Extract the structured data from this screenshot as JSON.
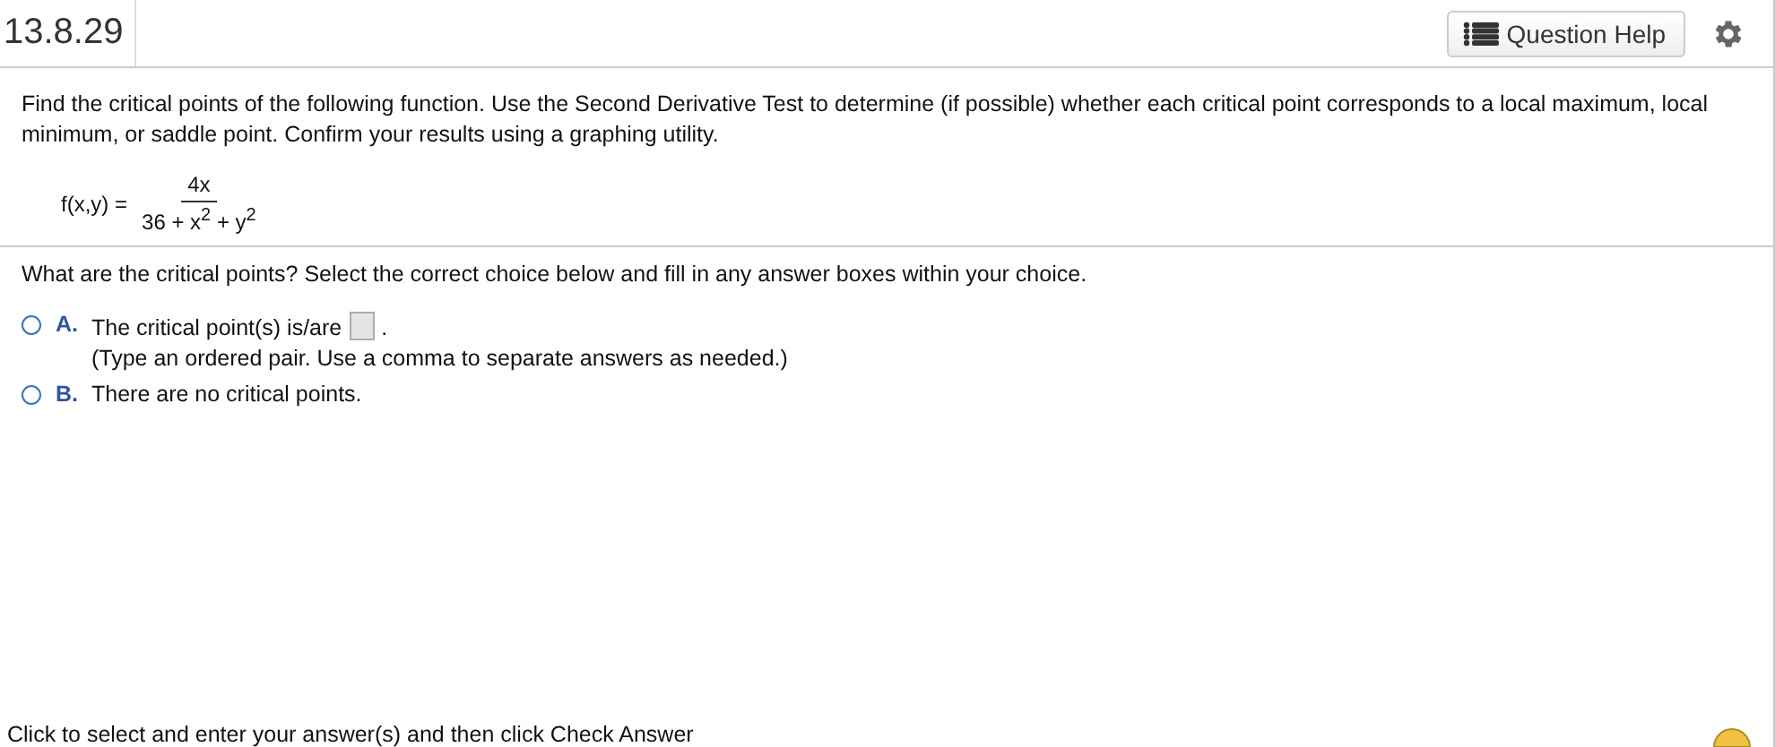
{
  "header": {
    "title": "13.8.29",
    "help_button": "Question Help"
  },
  "question": {
    "prompt": "Find the critical points of the following function. Use the Second Derivative Test to determine (if possible) whether each critical point corresponds to a local maximum, local minimum, or saddle point. Confirm your results using a graphing utility.",
    "formula": {
      "lhs": "f(x,y) =",
      "numerator": "4x",
      "denominator": "36 + x$^{2}$ + y$^{2}$"
    }
  },
  "instruction": "What are the critical points? Select the correct choice below and fill in any answer boxes within your choice.",
  "choices": [
    {
      "letter": "A.",
      "kind": "input",
      "text": "The critical point(s) is/are",
      "after": ".",
      "hint": "(Type an ordered pair. Use a comma to separate answers as needed.)",
      "selected": false
    },
    {
      "letter": "B.",
      "kind": "plain",
      "text": "There are no critical points.",
      "selected": false
    }
  ],
  "footer": {
    "text": "Click to select and enter your answer(s) and then click Check Answer"
  }
}
